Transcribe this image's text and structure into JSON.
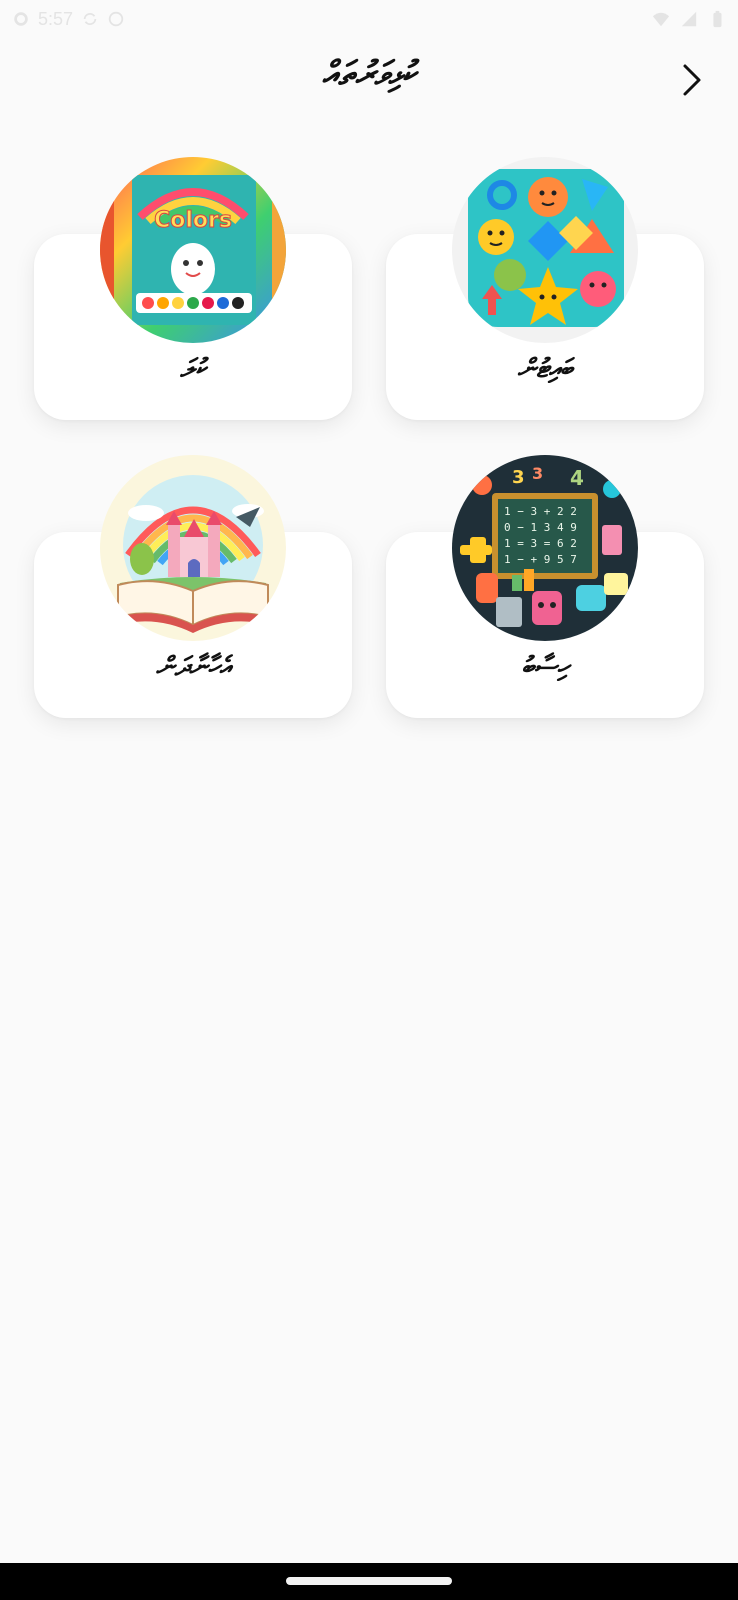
{
  "status_bar": {
    "time": "5:57",
    "icons": [
      "settings-icon",
      "sync-icon",
      "circle-icon",
      "wifi-icon",
      "signal-icon",
      "battery-icon"
    ]
  },
  "header": {
    "title": "ކުޅިވަރުތައް",
    "back_icon": "chevron-right-icon"
  },
  "cards": [
    {
      "label": "ކުލަ",
      "image": "colors-book-illustration"
    },
    {
      "label": "ބައިޓުން",
      "image": "shapes-illustration"
    },
    {
      "label": "އެހާނާދަން",
      "image": "storybook-castle-illustration"
    },
    {
      "label": "ހިސާބު",
      "image": "math-chalkboard-illustration"
    }
  ],
  "colors": {
    "background": "#fafafa",
    "card": "#ffffff",
    "text": "#111111"
  }
}
